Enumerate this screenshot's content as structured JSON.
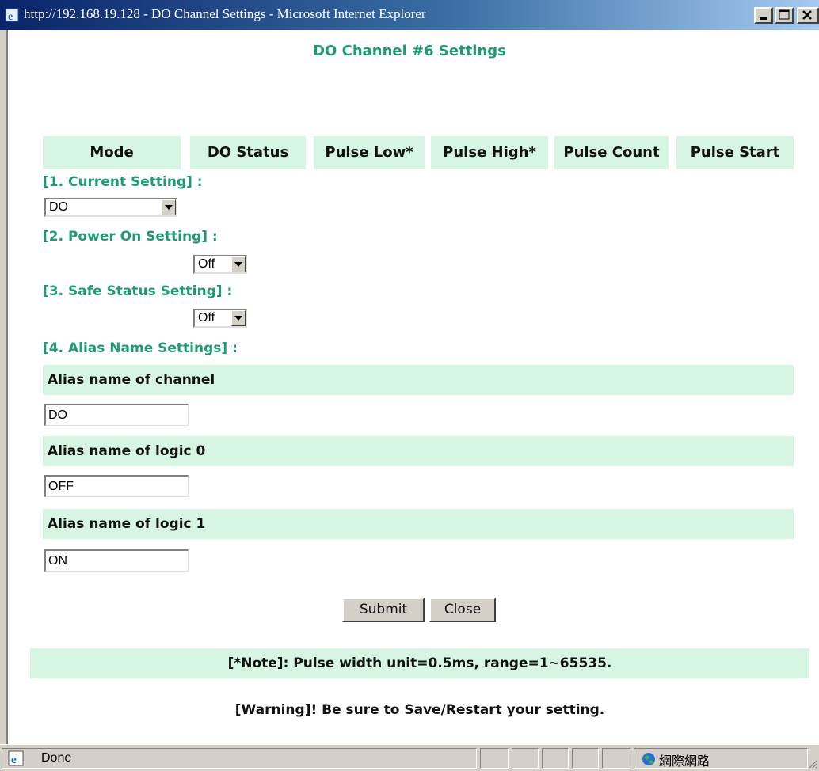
{
  "window": {
    "title": "http://192.168.19.128 - DO Channel Settings - Microsoft Internet Explorer"
  },
  "page": {
    "heading": "DO Channel #6 Settings",
    "columns": [
      "Mode",
      "DO Status",
      "Pulse Low*",
      "Pulse High*",
      "Pulse Count",
      "Pulse Start"
    ],
    "sections": {
      "current": "[1. Current Setting] :",
      "power_on": "[2. Power On Setting] :",
      "safe_status": "[3. Safe Status Setting] :",
      "alias": "[4. Alias Name Settings] :"
    },
    "selects": {
      "mode": "DO",
      "power_on": "Off",
      "safe_status": "Off"
    },
    "alias": {
      "channel_label": "Alias name of  channel",
      "channel_value": "DO",
      "logic0_label": "Alias name of logic 0",
      "logic0_value": "OFF",
      "logic1_label": "Alias name of logic 1",
      "logic1_value": "ON"
    },
    "buttons": {
      "submit": "Submit",
      "close": "Close"
    },
    "note": "[*Note]: Pulse width unit=0.5ms, range=1~65535.",
    "warning": "[Warning]! Be sure to Save/Restart your setting."
  },
  "statusbar": {
    "text": "Done",
    "zone": "網際網路"
  },
  "colors": {
    "accent_text": "#1e9b72",
    "band": "#d6f5e3",
    "titlebar": "#0a246a"
  },
  "icons": [
    "ie-icon",
    "minimize-icon",
    "maximize-icon",
    "close-icon",
    "dropdown-arrow-icon",
    "ie-page-icon",
    "internet-zone-icon"
  ]
}
